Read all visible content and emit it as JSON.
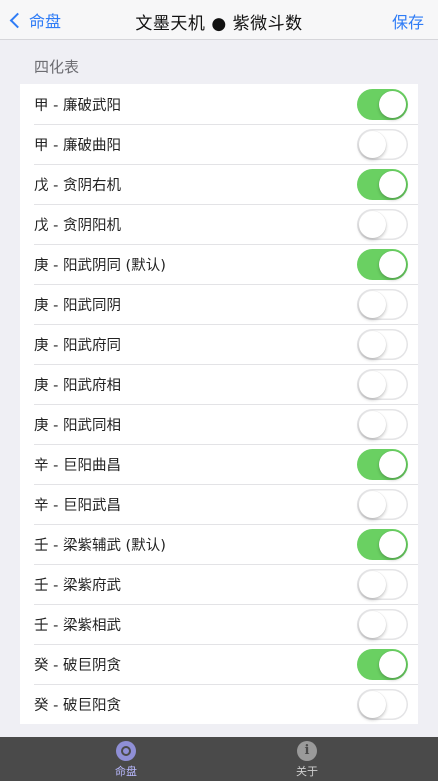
{
  "nav": {
    "back_label": "命盘",
    "title": "文墨天机 ● 紫微斗数",
    "save_label": "保存"
  },
  "section": {
    "header": "四化表"
  },
  "items": [
    {
      "label": "甲 - 廉破武阳",
      "on": true
    },
    {
      "label": "甲 - 廉破曲阳",
      "on": false
    },
    {
      "label": "戊 - 贪阴右机",
      "on": true
    },
    {
      "label": "戊 - 贪阴阳机",
      "on": false
    },
    {
      "label": "庚 - 阳武阴同 (默认)",
      "on": true
    },
    {
      "label": "庚 - 阳武同阴",
      "on": false
    },
    {
      "label": "庚 - 阳武府同",
      "on": false
    },
    {
      "label": "庚 - 阳武府相",
      "on": false
    },
    {
      "label": "庚 - 阳武同相",
      "on": false
    },
    {
      "label": "辛 - 巨阳曲昌",
      "on": true
    },
    {
      "label": "辛 - 巨阳武昌",
      "on": false
    },
    {
      "label": "壬 - 梁紫辅武 (默认)",
      "on": true
    },
    {
      "label": "壬 - 梁紫府武",
      "on": false
    },
    {
      "label": "壬 - 梁紫相武",
      "on": false
    },
    {
      "label": "癸 - 破巨阴贪",
      "on": true
    },
    {
      "label": "癸 - 破巨阳贪",
      "on": false
    }
  ],
  "tabbar": {
    "tabs": [
      {
        "label": "命盘",
        "icon": "chart-wheel-icon",
        "active": true
      },
      {
        "label": "关于",
        "icon": "info-icon",
        "active": false
      }
    ]
  },
  "colors": {
    "accent": "#2f7cf6",
    "toggle_on": "#6ad062",
    "tabbar_bg": "#4a4a4a"
  }
}
